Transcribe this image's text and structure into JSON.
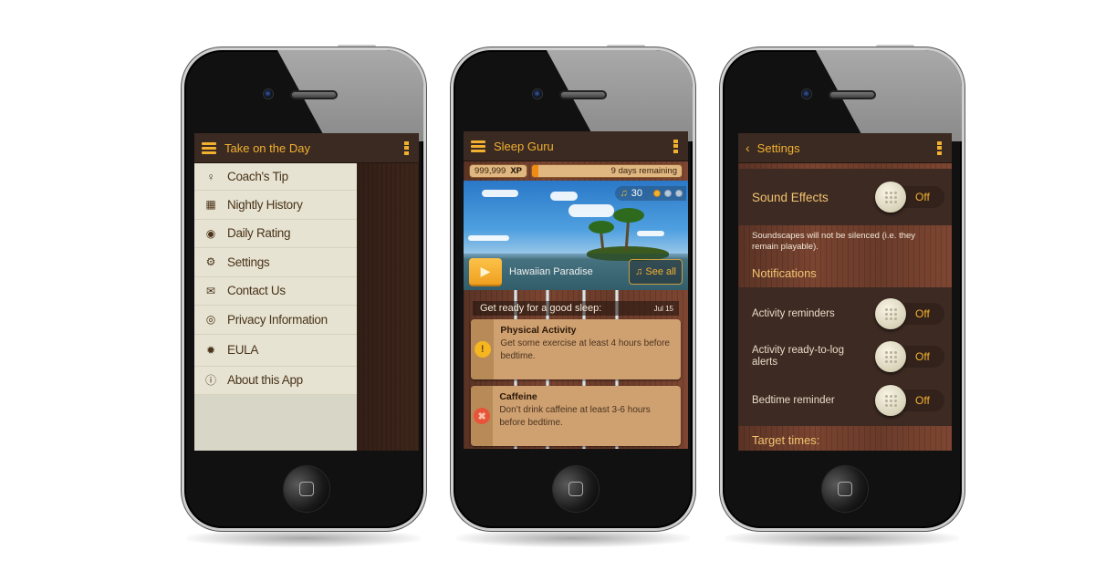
{
  "phones": {
    "menu": {
      "appbar": {
        "title": "Take on the Day"
      },
      "menu_items": [
        {
          "label": "Coach's Tip",
          "icon": "lightbulb-icon",
          "glyph": "💡"
        },
        {
          "label": "Nightly History",
          "icon": "calendar-icon",
          "glyph": "▦"
        },
        {
          "label": "Daily Rating",
          "icon": "target-icon",
          "glyph": "◉"
        },
        {
          "label": "Settings",
          "icon": "gears-icon",
          "glyph": "⚙"
        },
        {
          "label": "Contact Us",
          "icon": "envelope-icon",
          "glyph": "✉"
        },
        {
          "label": "Privacy Information",
          "icon": "eye-icon",
          "glyph": "👁"
        },
        {
          "label": "EULA",
          "icon": "seal-icon",
          "glyph": "✹"
        },
        {
          "label": "About this App",
          "icon": "info-icon",
          "glyph": "ℹ"
        }
      ]
    },
    "sleep": {
      "appbar": {
        "title": "Sleep Guru"
      },
      "xp": {
        "value": "999,999",
        "unit": "XP"
      },
      "trial": {
        "text": "9 days remaining",
        "progress_percent": 4
      },
      "hero": {
        "counter": "30",
        "pager_total": 3,
        "pager_active": 1,
        "track_title": "Hawaiian Paradise",
        "see_all_label": "See all"
      },
      "tips": {
        "heading": "Get ready for a good sleep:",
        "date": "Jul 15",
        "cards": [
          {
            "title": "Physical Activity",
            "body": "Get some exercise at least 4 hours before bedtime.",
            "status": "warning",
            "glyph": "!"
          },
          {
            "title": "Caffeine",
            "body": "Don’t drink caffeine at least 3-6 hours before bedtime.",
            "status": "error",
            "glyph": "✖"
          }
        ]
      }
    },
    "settings": {
      "appbar": {
        "title": "Settings",
        "back_glyph": "‹"
      },
      "sound_effects": {
        "label": "Sound Effects",
        "state": "Off"
      },
      "sound_note": "Soundscapes will not be silenced (i.e. they remain playable).",
      "notifications_heading": "Notifications",
      "toggles": [
        {
          "label": "Activity reminders",
          "state": "Off"
        },
        {
          "label": "Activity ready-to-log alerts",
          "state": "Off"
        },
        {
          "label": "Bedtime reminder",
          "state": "Off"
        }
      ],
      "target_times_heading": "Target times:"
    }
  },
  "colors": {
    "accent": "#f2b030",
    "appbar": "#3a2a22",
    "drawer": "#e6e3d3",
    "card": "#cfa070",
    "warning": "#f5b620",
    "error": "#e8543a"
  }
}
